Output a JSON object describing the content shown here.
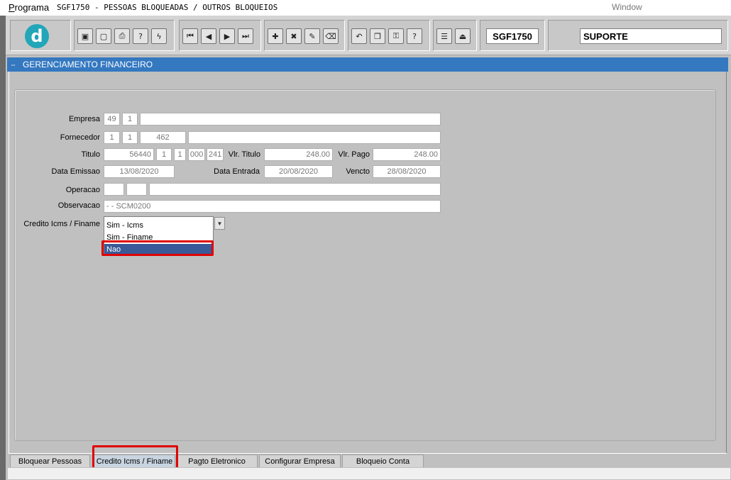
{
  "menubar": {
    "programa": "Programa",
    "title": "SGF1750 - PESSOAS BLOQUEADAS / OUTROS BLOQUEIOS",
    "window": "Window"
  },
  "toolbar": {
    "logo_letter": "d",
    "program_code": "SGF1750",
    "user": "SUPORTE",
    "icons": [
      "save-icon",
      "print-preview-icon",
      "printer-icon",
      "help-query-icon",
      "execute-query-icon",
      "first-record-icon",
      "previous-record-icon",
      "next-record-icon",
      "last-record-icon",
      "insert-record-icon",
      "delete-record-icon",
      "edit-record-icon",
      "clear-icon",
      "undo-icon",
      "copy-icon",
      "key-icon",
      "help-icon",
      "menu-icon",
      "exit-icon"
    ]
  },
  "window_title": "GERENCIAMENTO FINANCEIRO",
  "form": {
    "empresa": {
      "label": "Empresa",
      "code": "49",
      "sub": "1",
      "name": ""
    },
    "fornecedor": {
      "label": "Fornecedor",
      "a": "1",
      "b": "1",
      "code": "462",
      "name": ""
    },
    "titulo": {
      "label": "Titulo",
      "num": "56440",
      "a": "1",
      "b": "1",
      "c": "000",
      "d": "241"
    },
    "vlr_titulo": {
      "label": "Vlr. Titulo",
      "value": "248.00"
    },
    "vlr_pago": {
      "label": "Vlr. Pago",
      "value": "248.00"
    },
    "data_emissao": {
      "label": "Data Emissao",
      "value": "13/08/2020"
    },
    "data_entrada": {
      "label": "Data Entrada",
      "value": "20/08/2020"
    },
    "vencto": {
      "label": "Vencto",
      "value": "28/08/2020"
    },
    "operacao": {
      "label": "Operacao",
      "a": "",
      "b": "",
      "desc": ""
    },
    "observacao": {
      "label": "Observacao",
      "value": "-  - SCM0200"
    },
    "credito": {
      "label": "Credito Icms / Finame",
      "options": [
        "Sim - Icms",
        "Sim - Finame",
        "Nao"
      ],
      "selected": "Nao"
    }
  },
  "tabs": [
    "Bloquear Pessoas",
    "Credito Icms / Finame",
    "Pagto Eletronico",
    "Configurar Empresa",
    "Bloqueio Conta"
  ],
  "active_tab": "Credito Icms / Finame"
}
